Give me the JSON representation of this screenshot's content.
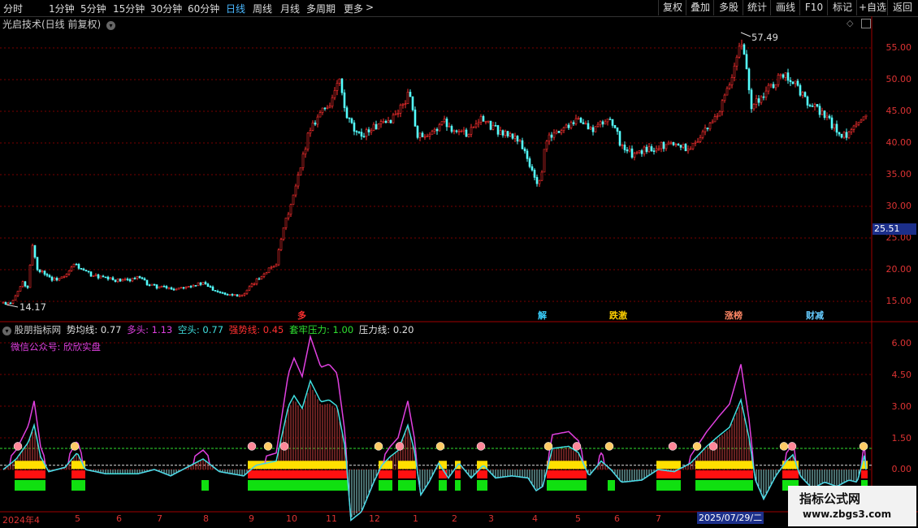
{
  "toolbar": {
    "tabs": [
      "分时",
      "1分钟",
      "5分钟",
      "15分钟",
      "30分钟",
      "60分钟",
      "日线",
      "周线",
      "月线",
      "多周期",
      "更多"
    ],
    "active_tab": "日线",
    "more_arrow": ">",
    "right_buttons": [
      "复权",
      "叠加",
      "多股",
      "统计",
      "画线",
      "F10",
      "标记",
      "+自选",
      "返回"
    ]
  },
  "main_chart": {
    "title": "光启技术(日线 前复权)",
    "high_label": "57.49",
    "low_label": "14.17",
    "price_tag": "25.51",
    "yticks": [
      "55.00",
      "50.00",
      "45.00",
      "40.00",
      "35.00",
      "30.00",
      "25.00",
      "20.00",
      "15.00"
    ],
    "events": [
      {
        "text": "多",
        "color": "#ff3030"
      },
      {
        "text": "解",
        "color": "#3ad1ff"
      },
      {
        "text": "跌激",
        "color": "#ffd000"
      },
      {
        "text": "涨榜",
        "color": "#ff8866"
      },
      {
        "text": "财减",
        "color": "#6cf"
      }
    ]
  },
  "indicator": {
    "name": "股朋指标网",
    "items": [
      {
        "label": "势均线: 0.77",
        "color": "#e0e0e0"
      },
      {
        "label": "多头: 1.13",
        "color": "#e040e0"
      },
      {
        "label": "空头: 0.77",
        "color": "#40e0e0"
      },
      {
        "label": "强势线: 0.45",
        "color": "#ff3030"
      },
      {
        "label": "套牢压力: 1.00",
        "color": "#30e030"
      },
      {
        "label": "压力线: 0.20",
        "color": "#e0e0e0"
      }
    ],
    "wechat": "微信公众号: 欣欣实盘",
    "yticks": [
      "6.00",
      "4.50",
      "3.00",
      "1.50",
      "0.00"
    ]
  },
  "xaxis": {
    "labels": [
      "2024年4",
      "5",
      "6",
      "7",
      "8",
      "9",
      "10",
      "11",
      "12",
      "1",
      "2",
      "3",
      "4",
      "5",
      "6",
      "7"
    ],
    "cursor_date": "2025/07/29/二"
  },
  "watermark": {
    "line1": "指标公式网",
    "line2": "www.zbgs3.com"
  },
  "colors": {
    "bg": "#000000",
    "up": "#ff3030",
    "down": "#54ffff",
    "grid": "#7a0000"
  },
  "chart_data": {
    "type": "candlestick",
    "title": "光启技术(日线 前复权)",
    "ylim": [
      13,
      58
    ],
    "price_path": [
      [
        0,
        15.2
      ],
      [
        8,
        14.3
      ],
      [
        18,
        15.6
      ],
      [
        28,
        18
      ],
      [
        34,
        17
      ],
      [
        40,
        24
      ],
      [
        46,
        20
      ],
      [
        55,
        19.5
      ],
      [
        65,
        18.4
      ],
      [
        80,
        18.8
      ],
      [
        92,
        21
      ],
      [
        100,
        20
      ],
      [
        112,
        19.2
      ],
      [
        130,
        18.6
      ],
      [
        150,
        18.2
      ],
      [
        170,
        18.8
      ],
      [
        185,
        17.5
      ],
      [
        200,
        17.2
      ],
      [
        215,
        17
      ],
      [
        230,
        17.5
      ],
      [
        250,
        17.8
      ],
      [
        265,
        16.8
      ],
      [
        280,
        16.2
      ],
      [
        300,
        16
      ],
      [
        310,
        17.5
      ],
      [
        325,
        19.5
      ],
      [
        340,
        21
      ],
      [
        350,
        27
      ],
      [
        360,
        31
      ],
      [
        370,
        36
      ],
      [
        380,
        42
      ],
      [
        395,
        45
      ],
      [
        405,
        46
      ],
      [
        412,
        48
      ],
      [
        418,
        50
      ],
      [
        425,
        44.5
      ],
      [
        440,
        41
      ],
      [
        460,
        42.5
      ],
      [
        475,
        43
      ],
      [
        490,
        45
      ],
      [
        505,
        48
      ],
      [
        512,
        41.5
      ],
      [
        525,
        40.5
      ],
      [
        545,
        43.5
      ],
      [
        560,
        42
      ],
      [
        575,
        41.5
      ],
      [
        590,
        44
      ],
      [
        605,
        42.5
      ],
      [
        620,
        41.5
      ],
      [
        640,
        40.5
      ],
      [
        650,
        37
      ],
      [
        660,
        34
      ],
      [
        665,
        33.5
      ],
      [
        672,
        40.5
      ],
      [
        690,
        42
      ],
      [
        710,
        44
      ],
      [
        728,
        42
      ],
      [
        740,
        43
      ],
      [
        752,
        44
      ],
      [
        765,
        39.5
      ],
      [
        780,
        38
      ],
      [
        795,
        39
      ],
      [
        810,
        39.5
      ],
      [
        830,
        40
      ],
      [
        850,
        39
      ],
      [
        860,
        41
      ],
      [
        870,
        42
      ],
      [
        885,
        45
      ],
      [
        895,
        48
      ],
      [
        905,
        52
      ],
      [
        912,
        56
      ],
      [
        918,
        53
      ],
      [
        925,
        46
      ],
      [
        935,
        47
      ],
      [
        950,
        49
      ],
      [
        965,
        51
      ],
      [
        975,
        50
      ],
      [
        985,
        48
      ],
      [
        995,
        46
      ],
      [
        1010,
        45
      ],
      [
        1020,
        43.5
      ],
      [
        1030,
        42
      ],
      [
        1040,
        41
      ],
      [
        1055,
        42.5
      ],
      [
        1065,
        45
      ]
    ]
  }
}
